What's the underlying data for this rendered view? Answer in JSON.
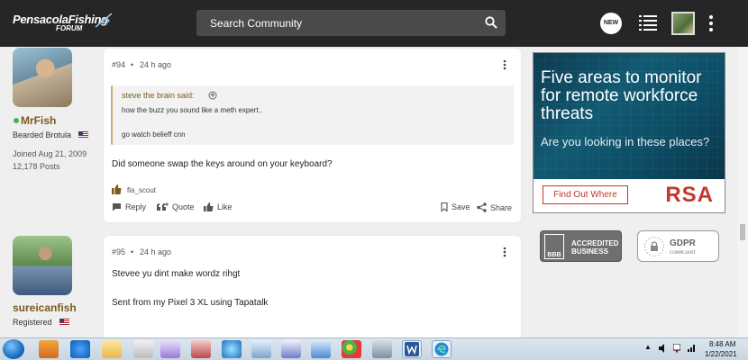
{
  "header": {
    "logo_main": "PensacolaFishing",
    "logo_sub": "FORUM",
    "search_placeholder": "Search Community",
    "new_badge": "NEW"
  },
  "posts": [
    {
      "number": "#94",
      "sep": "•",
      "time": "24 h ago",
      "user": {
        "name": "MrFish",
        "rank": "Bearded Brotula",
        "joined": "Joined Aug 21, 2009",
        "posts": "12,178 Posts"
      },
      "quote": {
        "author": "steve the brain said:",
        "line1": "how the buzz you sound like a meth expert..",
        "line2": "go watch belieff cnn"
      },
      "body": "Did someone swap the keys around on your keyboard?",
      "reaction_user": "fla_scout",
      "actions": {
        "reply": "Reply",
        "quote": "Quote",
        "like": "Like",
        "save": "Save",
        "share": "Share"
      }
    },
    {
      "number": "#95",
      "sep": "•",
      "time": "24 h ago",
      "user": {
        "name": "sureicanfish",
        "rank": "Registered"
      },
      "body_line1": "Stevee yu dint make wordz rihgt",
      "body_line2": "Sent from my Pixel 3 XL using Tapatalk"
    }
  ],
  "ad": {
    "headline_1": "Five areas to monitor",
    "headline_2": "for remote workforce",
    "headline_3": "threats",
    "subline": "Are you looking in these places?",
    "cta": "Find Out Where",
    "brand": "RSA"
  },
  "badges": {
    "bbb_logo": "BBB",
    "bbb_line1": "ACCREDITED",
    "bbb_line2": "BUSINESS",
    "gdpr_title": "GDPR",
    "gdpr_sub": "COMPLIANT"
  },
  "taskbar": {
    "time": "8:48 AM",
    "date": "1/22/2021"
  },
  "colors": {
    "topbar": "#262626",
    "username": "#7a5a1e",
    "online": "#4caf50",
    "ad_accent": "#c0392b"
  }
}
